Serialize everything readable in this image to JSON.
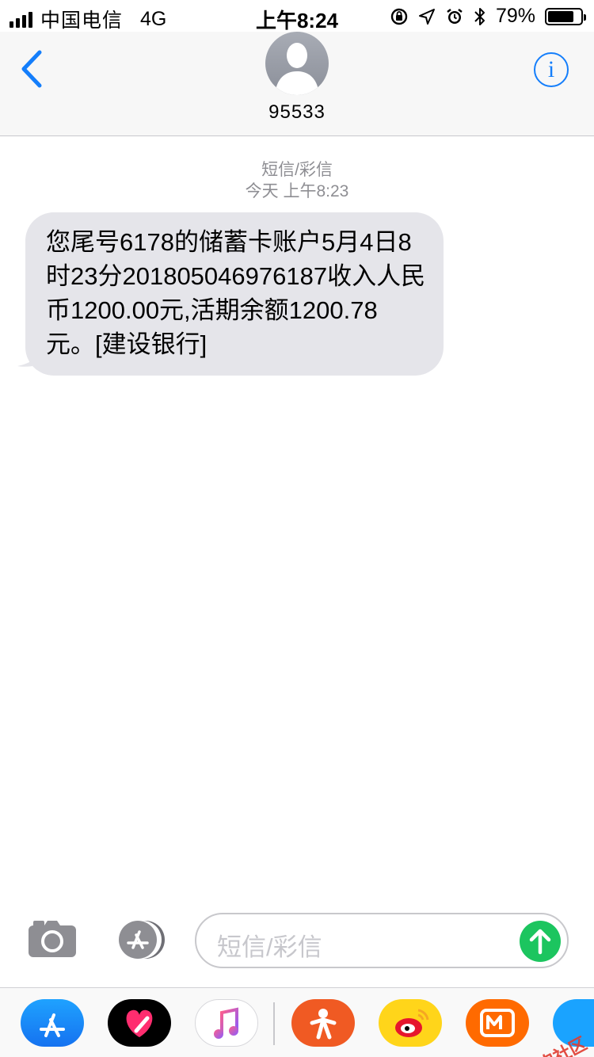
{
  "status_bar": {
    "carrier": "中国电信",
    "network": "4G",
    "time": "上午8:24",
    "battery_percent": "79%",
    "battery_level": 0.79
  },
  "header": {
    "contact": "95533"
  },
  "conversation": {
    "message_type": "短信/彩信",
    "timestamp": "今天 上午8:23",
    "message_text": "您尾号6178的储蓄卡账户5月4日8时23分201805046976187收入人民币1200.00元,活期余额1200.78元。[建设银行]"
  },
  "composer": {
    "placeholder": "短信/彩信"
  },
  "drawer_apps": [
    "app-store",
    "digital-touch",
    "music",
    "dianping",
    "weibo",
    "mango-tv",
    "partial-app"
  ],
  "watermark": "卡农社区",
  "colors": {
    "ios_blue": "#147efb",
    "send_green": "#1cc55f",
    "bubble_gray": "#e5e5ea",
    "meta_gray": "#8e8e93"
  }
}
